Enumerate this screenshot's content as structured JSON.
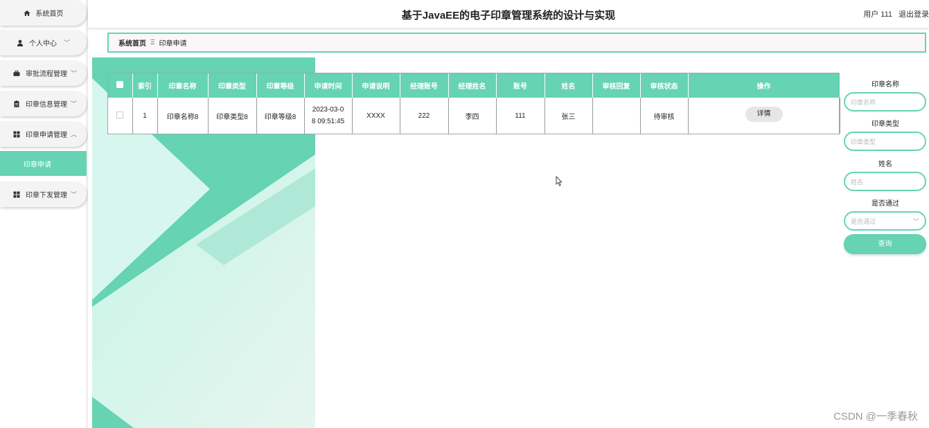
{
  "header": {
    "title": "基于JavaEE的电子印章管理系统的设计与实现",
    "user": "用户 111",
    "logout": "退出登录"
  },
  "sidebar": {
    "items": [
      {
        "label": "系统首页",
        "icon": "home-icon"
      },
      {
        "label": "个人中心",
        "icon": "user-icon",
        "chevron": "﹀"
      },
      {
        "label": "审批流程管理",
        "icon": "briefcase-icon",
        "chevron": "﹀"
      },
      {
        "label": "印章信息管理",
        "icon": "clipboard-icon",
        "chevron": "﹀"
      },
      {
        "label": "印章申请管理",
        "icon": "grid-icon",
        "chevron": "︿"
      },
      {
        "label": "印章下发管理",
        "icon": "grid-icon",
        "chevron": "﹀"
      }
    ],
    "sub_item": "印章申请"
  },
  "breadcrumb": {
    "home": "系统首页",
    "separator": "Ξ",
    "current": "印章申请"
  },
  "table": {
    "headers": [
      "索引",
      "印章名称",
      "印章类型",
      "印章等级",
      "申请时间",
      "申请说明",
      "经理账号",
      "经理姓名",
      "账号",
      "姓名",
      "审核回复",
      "审核状态",
      "操作"
    ],
    "rows": [
      {
        "index": "1",
        "seal_name": "印章名称8",
        "seal_type": "印章类型8",
        "seal_level": "印章等级8",
        "apply_time_1": "2023-03-0",
        "apply_time_2": "8 09:51:45",
        "description": "XXXX",
        "manager_account": "222",
        "manager_name": "李四",
        "account": "111",
        "name": "张三",
        "review_reply": "",
        "review_status": "待审核",
        "action": "详情"
      }
    ]
  },
  "search": {
    "seal_name_label": "印章名称",
    "seal_name_placeholder": "印章名称",
    "seal_type_label": "印章类型",
    "seal_type_placeholder": "印章类型",
    "name_label": "姓名",
    "name_placeholder": "姓名",
    "passed_label": "是否通过",
    "passed_placeholder": "是否通过",
    "query_button": "查询"
  },
  "watermark": "CSDN @一季春秋",
  "colors": {
    "accent": "#66d3b3",
    "accent_light": "#cdf7ea"
  }
}
